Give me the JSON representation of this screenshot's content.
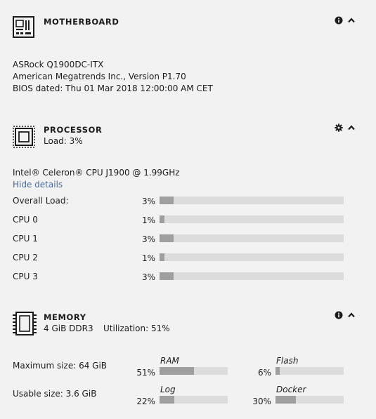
{
  "motherboard": {
    "title": "MOTHERBOARD",
    "board": "ASRock Q1900DC-ITX",
    "bios_vendor": "American Megatrends Inc., Version P1.70",
    "bios_date": "BIOS dated: Thu 01 Mar 2018 12:00:00 AM CET",
    "icon": "motherboard-icon"
  },
  "processor": {
    "title": "PROCESSOR",
    "load_summary": "Load: 3%",
    "model": "Intel® Celeron® CPU J1900 @ 1.99GHz",
    "toggle_details": "Hide details",
    "icon": "processor-icon",
    "rows": [
      {
        "label": "Overall Load:",
        "value": "3%",
        "fraction": 0.03
      },
      {
        "label": "CPU 0",
        "value": "1%",
        "fraction": 0.01
      },
      {
        "label": "CPU 1",
        "value": "3%",
        "fraction": 0.03
      },
      {
        "label": "CPU 2",
        "value": "1%",
        "fraction": 0.01
      },
      {
        "label": "CPU 3",
        "value": "3%",
        "fraction": 0.03
      }
    ]
  },
  "memory": {
    "title": "MEMORY",
    "installed": "4 GiB DDR3",
    "utilization": "Utilization: 51%",
    "max_size": "Maximum size: 64 GiB",
    "usable_size": "Usable size: 3.6 GiB",
    "icon": "memory-icon",
    "gauges": [
      {
        "name": "RAM",
        "value": "51%",
        "fraction": 0.51
      },
      {
        "name": "Flash",
        "value": "6%",
        "fraction": 0.06
      },
      {
        "name": "Log",
        "value": "22%",
        "fraction": 0.22
      },
      {
        "name": "Docker",
        "value": "30%",
        "fraction": 0.3
      }
    ]
  },
  "colors": {
    "background": "#f2f2f2",
    "text": "#1c1c1c",
    "link": "#486a99",
    "bar_track": "#dcdcdc",
    "bar_fill": "#9f9f9f"
  }
}
